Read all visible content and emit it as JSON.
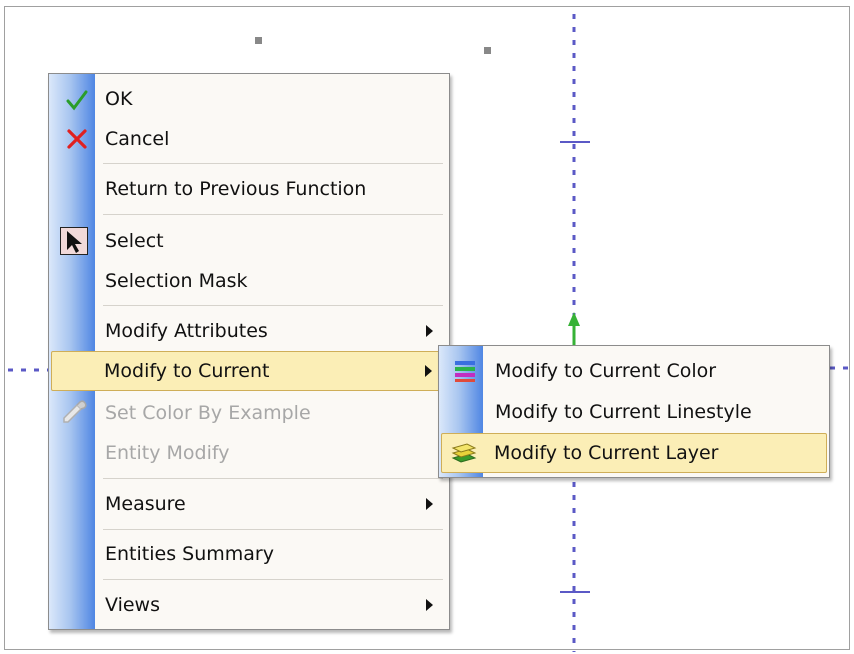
{
  "colors": {
    "guide_line": "#5b59c6",
    "y_axis_arrow": "#36b236",
    "selection_handle": "#888888",
    "highlight_bg": "#fbeeb6"
  },
  "context_menu": {
    "items": [
      {
        "label": "OK",
        "icon": "check-icon"
      },
      {
        "label": "Cancel",
        "icon": "cross-icon"
      },
      {
        "label": "Return to Previous Function"
      },
      {
        "label": "Select",
        "icon": "cursor-arrow-icon"
      },
      {
        "label": "Selection Mask"
      },
      {
        "label": "Modify Attributes",
        "submenu": true
      },
      {
        "label": "Modify to Current",
        "submenu": true,
        "highlighted": true
      },
      {
        "label": "Set Color By Example",
        "icon": "eyedropper-icon",
        "disabled": true
      },
      {
        "label": "Entity Modify",
        "disabled": true
      },
      {
        "label": "Measure",
        "submenu": true
      },
      {
        "label": "Entities Summary"
      },
      {
        "label": "Views",
        "submenu": true
      }
    ]
  },
  "submenu": {
    "items": [
      {
        "label": "Modify to Current Color",
        "icon": "color-bars-icon"
      },
      {
        "label": "Modify to Current Linestyle"
      },
      {
        "label": "Modify to Current Layer",
        "icon": "layers-icon",
        "highlighted": true
      }
    ]
  }
}
